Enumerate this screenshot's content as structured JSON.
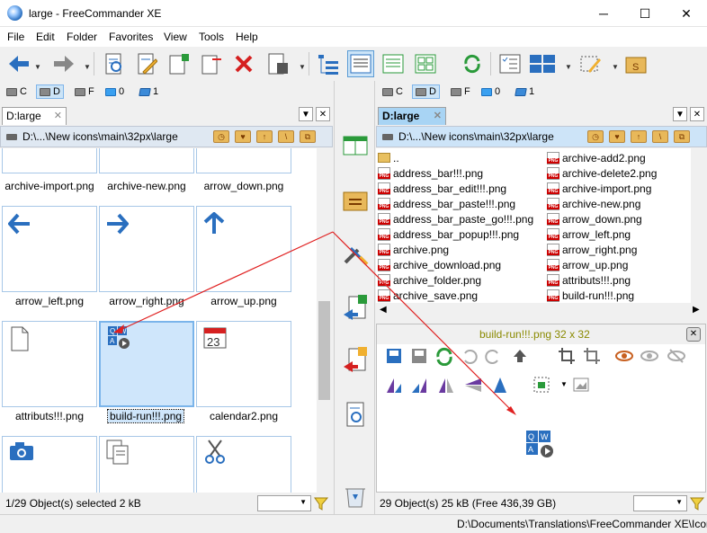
{
  "window": {
    "title": "large - FreeCommander XE",
    "min": "─",
    "max": "☐",
    "close": "✕"
  },
  "menu": [
    "File",
    "Edit",
    "Folder",
    "Favorites",
    "View",
    "Tools",
    "Help"
  ],
  "drives": {
    "left": [
      {
        "label": "C"
      },
      {
        "label": "D"
      },
      {
        "label": "F"
      },
      {
        "label": "0"
      },
      {
        "label": "1"
      }
    ],
    "right": [
      {
        "label": "C"
      },
      {
        "label": "D"
      },
      {
        "label": "F"
      },
      {
        "label": "0"
      },
      {
        "label": "1"
      }
    ]
  },
  "left": {
    "tab": "D:large",
    "path": "D:\\...\\New icons\\main\\32px\\large",
    "thumbs": [
      {
        "label": "archive-import.png"
      },
      {
        "label": "archive-new.png"
      },
      {
        "label": "arrow_down.png"
      },
      {
        "label": "arrow_left.png"
      },
      {
        "label": "arrow_right.png"
      },
      {
        "label": "arrow_up.png"
      },
      {
        "label": "attributs!!!.png"
      },
      {
        "label": "build-run!!!.png"
      },
      {
        "label": "calendar2.png"
      }
    ],
    "status": "1/29 Object(s) selected   2 kB",
    "calendar_day": "23"
  },
  "right": {
    "tab": "D:large",
    "path": "D:\\...\\New icons\\main\\32px\\large",
    "col1": [
      "..",
      "address_bar!!!.png",
      "address_bar_edit!!!.png",
      "address_bar_paste!!!.png",
      "address_bar_paste_go!!!.png",
      "address_bar_popup!!!.png",
      "archive.png",
      "archive_download.png",
      "archive_folder.png",
      "archive_save.png"
    ],
    "col2": [
      "archive-add2.png",
      "archive-delete2.png",
      "archive-import.png",
      "archive-new.png",
      "arrow_down.png",
      "arrow_left.png",
      "arrow_right.png",
      "arrow_up.png",
      "attributs!!!.png",
      "build-run!!!.png"
    ],
    "preview_title": "build-run!!!.png   32 x 32",
    "status": "29 Object(s)    25 kB   (Free 436,39 GB)"
  },
  "bottom_path": "D:\\Documents\\Translations\\FreeCommander XE\\Icon",
  "colors": {
    "accent": "#2a6fbf",
    "selection": "#cfe6fb",
    "annotation": "#e02020"
  }
}
